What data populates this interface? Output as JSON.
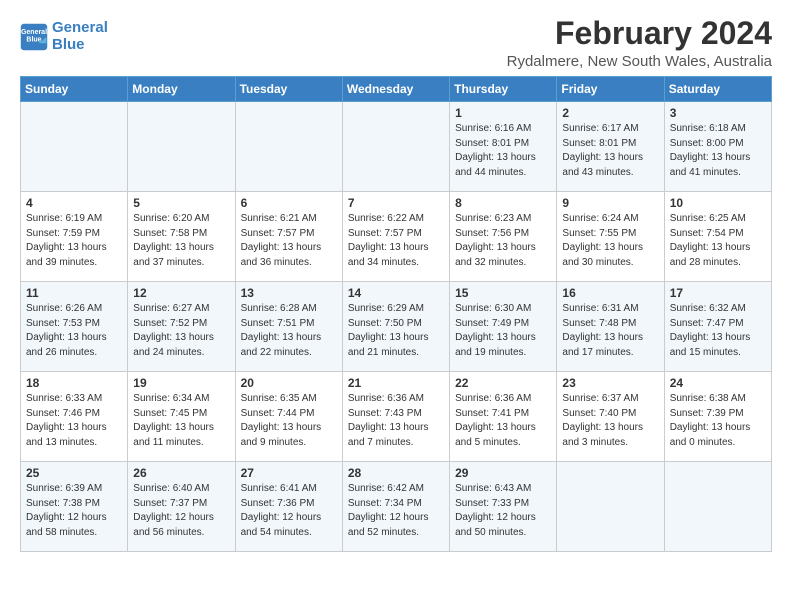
{
  "logo": {
    "line1": "General",
    "line2": "Blue"
  },
  "title": "February 2024",
  "subtitle": "Rydalmere, New South Wales, Australia",
  "headers": [
    "Sunday",
    "Monday",
    "Tuesday",
    "Wednesday",
    "Thursday",
    "Friday",
    "Saturday"
  ],
  "weeks": [
    [
      {
        "day": "",
        "info": ""
      },
      {
        "day": "",
        "info": ""
      },
      {
        "day": "",
        "info": ""
      },
      {
        "day": "",
        "info": ""
      },
      {
        "day": "1",
        "info": "Sunrise: 6:16 AM\nSunset: 8:01 PM\nDaylight: 13 hours\nand 44 minutes."
      },
      {
        "day": "2",
        "info": "Sunrise: 6:17 AM\nSunset: 8:01 PM\nDaylight: 13 hours\nand 43 minutes."
      },
      {
        "day": "3",
        "info": "Sunrise: 6:18 AM\nSunset: 8:00 PM\nDaylight: 13 hours\nand 41 minutes."
      }
    ],
    [
      {
        "day": "4",
        "info": "Sunrise: 6:19 AM\nSunset: 7:59 PM\nDaylight: 13 hours\nand 39 minutes."
      },
      {
        "day": "5",
        "info": "Sunrise: 6:20 AM\nSunset: 7:58 PM\nDaylight: 13 hours\nand 37 minutes."
      },
      {
        "day": "6",
        "info": "Sunrise: 6:21 AM\nSunset: 7:57 PM\nDaylight: 13 hours\nand 36 minutes."
      },
      {
        "day": "7",
        "info": "Sunrise: 6:22 AM\nSunset: 7:57 PM\nDaylight: 13 hours\nand 34 minutes."
      },
      {
        "day": "8",
        "info": "Sunrise: 6:23 AM\nSunset: 7:56 PM\nDaylight: 13 hours\nand 32 minutes."
      },
      {
        "day": "9",
        "info": "Sunrise: 6:24 AM\nSunset: 7:55 PM\nDaylight: 13 hours\nand 30 minutes."
      },
      {
        "day": "10",
        "info": "Sunrise: 6:25 AM\nSunset: 7:54 PM\nDaylight: 13 hours\nand 28 minutes."
      }
    ],
    [
      {
        "day": "11",
        "info": "Sunrise: 6:26 AM\nSunset: 7:53 PM\nDaylight: 13 hours\nand 26 minutes."
      },
      {
        "day": "12",
        "info": "Sunrise: 6:27 AM\nSunset: 7:52 PM\nDaylight: 13 hours\nand 24 minutes."
      },
      {
        "day": "13",
        "info": "Sunrise: 6:28 AM\nSunset: 7:51 PM\nDaylight: 13 hours\nand 22 minutes."
      },
      {
        "day": "14",
        "info": "Sunrise: 6:29 AM\nSunset: 7:50 PM\nDaylight: 13 hours\nand 21 minutes."
      },
      {
        "day": "15",
        "info": "Sunrise: 6:30 AM\nSunset: 7:49 PM\nDaylight: 13 hours\nand 19 minutes."
      },
      {
        "day": "16",
        "info": "Sunrise: 6:31 AM\nSunset: 7:48 PM\nDaylight: 13 hours\nand 17 minutes."
      },
      {
        "day": "17",
        "info": "Sunrise: 6:32 AM\nSunset: 7:47 PM\nDaylight: 13 hours\nand 15 minutes."
      }
    ],
    [
      {
        "day": "18",
        "info": "Sunrise: 6:33 AM\nSunset: 7:46 PM\nDaylight: 13 hours\nand 13 minutes."
      },
      {
        "day": "19",
        "info": "Sunrise: 6:34 AM\nSunset: 7:45 PM\nDaylight: 13 hours\nand 11 minutes."
      },
      {
        "day": "20",
        "info": "Sunrise: 6:35 AM\nSunset: 7:44 PM\nDaylight: 13 hours\nand 9 minutes."
      },
      {
        "day": "21",
        "info": "Sunrise: 6:36 AM\nSunset: 7:43 PM\nDaylight: 13 hours\nand 7 minutes."
      },
      {
        "day": "22",
        "info": "Sunrise: 6:36 AM\nSunset: 7:41 PM\nDaylight: 13 hours\nand 5 minutes."
      },
      {
        "day": "23",
        "info": "Sunrise: 6:37 AM\nSunset: 7:40 PM\nDaylight: 13 hours\nand 3 minutes."
      },
      {
        "day": "24",
        "info": "Sunrise: 6:38 AM\nSunset: 7:39 PM\nDaylight: 13 hours\nand 0 minutes."
      }
    ],
    [
      {
        "day": "25",
        "info": "Sunrise: 6:39 AM\nSunset: 7:38 PM\nDaylight: 12 hours\nand 58 minutes."
      },
      {
        "day": "26",
        "info": "Sunrise: 6:40 AM\nSunset: 7:37 PM\nDaylight: 12 hours\nand 56 minutes."
      },
      {
        "day": "27",
        "info": "Sunrise: 6:41 AM\nSunset: 7:36 PM\nDaylight: 12 hours\nand 54 minutes."
      },
      {
        "day": "28",
        "info": "Sunrise: 6:42 AM\nSunset: 7:34 PM\nDaylight: 12 hours\nand 52 minutes."
      },
      {
        "day": "29",
        "info": "Sunrise: 6:43 AM\nSunset: 7:33 PM\nDaylight: 12 hours\nand 50 minutes."
      },
      {
        "day": "",
        "info": ""
      },
      {
        "day": "",
        "info": ""
      }
    ]
  ]
}
